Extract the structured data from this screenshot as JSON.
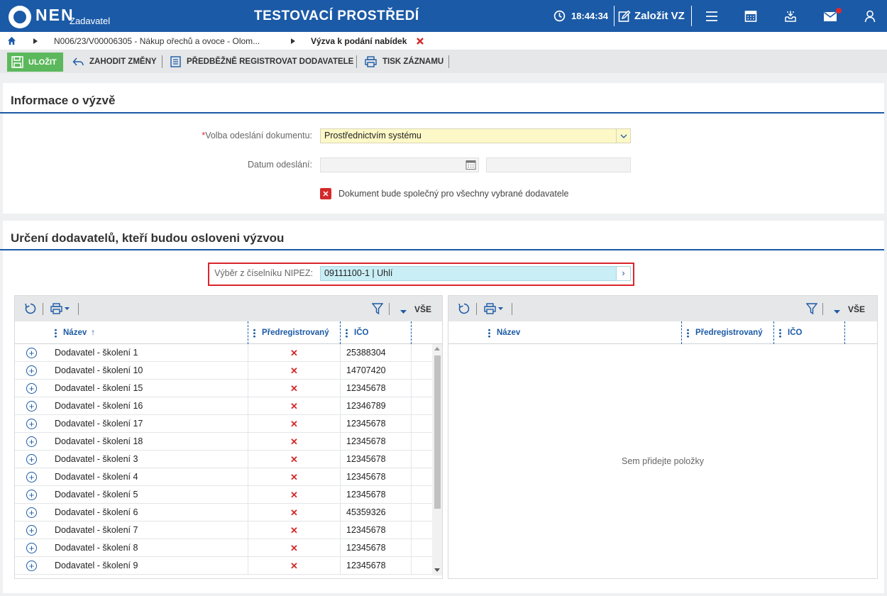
{
  "header": {
    "logo_text": "NEN",
    "logo_sub": "Zadavatel",
    "title": "TESTOVACÍ PROSTŘEDÍ",
    "time": "18:44:34",
    "create_label": "Založit VZ"
  },
  "breadcrumb": {
    "item1": "N006/23/V00006305 - Nákup ořechů a ovoce - Olom...",
    "current": "Výzva k podání nabídek"
  },
  "toolbar": {
    "save": "ULOŽIT",
    "discard": "ZAHODIT ZMĚNY",
    "preregister": "PŘEDBĚŽNĚ REGISTROVAT DODAVATELE",
    "print": "TISK ZÁZNAMU"
  },
  "info": {
    "title": "Informace o výzvě",
    "send_label": "Volba odeslání dokumentu:",
    "send_value": "Prostřednictvím systému",
    "date_label": "Datum odeslání:",
    "checkbox_label": "Dokument bude společný pro všechny vybrané dodavatele"
  },
  "suppliers": {
    "title": "Určení dodavatelů, kteří budou osloveni výzvou",
    "nipez_label": "Výběr z číselníku NIPEZ:",
    "nipez_value": "09111100-1 | Uhlí"
  },
  "left_grid": {
    "vse": "VŠE",
    "col_name": "Název",
    "col_prereg": "Předregistrovaný",
    "col_ico": "IČO",
    "rows": [
      {
        "name": "Dodavatel - školení 1",
        "prereg": "✕",
        "ico": "25388304"
      },
      {
        "name": "Dodavatel - školení 10",
        "prereg": "✕",
        "ico": "14707420"
      },
      {
        "name": "Dodavatel - školení 15",
        "prereg": "✕",
        "ico": "12345678"
      },
      {
        "name": "Dodavatel - školení 16",
        "prereg": "✕",
        "ico": "12346789"
      },
      {
        "name": "Dodavatel - školení 17",
        "prereg": "✕",
        "ico": "12345678"
      },
      {
        "name": "Dodavatel - školení 18",
        "prereg": "✕",
        "ico": "12345678"
      },
      {
        "name": "Dodavatel - školení 3",
        "prereg": "✕",
        "ico": "12345678"
      },
      {
        "name": "Dodavatel - školení 4",
        "prereg": "✕",
        "ico": "12345678"
      },
      {
        "name": "Dodavatel - školení 5",
        "prereg": "✕",
        "ico": "12345678"
      },
      {
        "name": "Dodavatel - školení 6",
        "prereg": "✕",
        "ico": "45359326"
      },
      {
        "name": "Dodavatel - školení 7",
        "prereg": "✕",
        "ico": "12345678"
      },
      {
        "name": "Dodavatel - školení 8",
        "prereg": "✕",
        "ico": "12345678"
      },
      {
        "name": "Dodavatel - školení 9",
        "prereg": "✕",
        "ico": "12345678"
      }
    ]
  },
  "right_grid": {
    "vse": "VŠE",
    "col_name": "Název",
    "col_prereg": "Předregistrovaný",
    "col_ico": "IČO",
    "empty": "Sem přidejte položky"
  },
  "icons": {
    "plus": "+",
    "remove": "✕",
    "chevron_right": "›",
    "sort_up": "↑"
  },
  "colors": {
    "brand": "#1b5aa6",
    "save": "#5cb85c",
    "danger": "#d42a2a"
  }
}
